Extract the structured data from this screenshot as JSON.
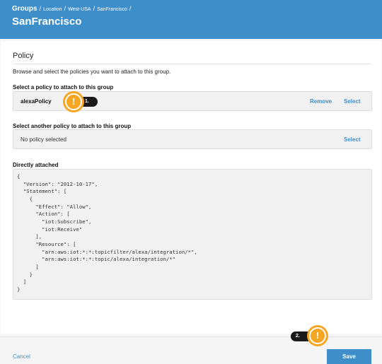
{
  "header": {
    "breadcrumb": [
      "Groups",
      "Location",
      "West-USA",
      "SanFrancisco"
    ],
    "separator": "/",
    "title": "SanFrancisco"
  },
  "policy": {
    "section_title": "Policy",
    "description": "Browse and select the policies you want to attach to this group.",
    "attach": {
      "label": "Select a policy to attach to this group",
      "value": "alexaPolicy",
      "remove_label": "Remove",
      "select_label": "Select"
    },
    "another": {
      "label": "Select another policy to attach to this group",
      "value": "No policy selected",
      "select_label": "Select"
    },
    "directly_attached": {
      "label": "Directly attached",
      "code_lines": [
        "{",
        "  \"Version\": \"2012-10-17\",",
        "  \"Statement\": [",
        "    {",
        "      \"Effect\": \"Allow\",",
        "      \"Action\": [",
        "        \"iot:Subscribe\",",
        "        \"iot:Receive\"",
        "      ],",
        "      \"Resource\": [",
        "        \"arn:aws:iot:*:*:topicfilter/alexa/integration/*\",",
        "        \"arn:aws:iot:*:*:topic/alexa/integration/*\"",
        "      ]",
        "    }",
        "  ]",
        "}"
      ]
    }
  },
  "footer": {
    "cancel_label": "Cancel",
    "save_label": "Save"
  },
  "callouts": {
    "step1": "1.",
    "step2": "2.",
    "icon_glyph": "!"
  },
  "colors": {
    "accent": "#3d8ec9",
    "callout": "#f5a623"
  }
}
